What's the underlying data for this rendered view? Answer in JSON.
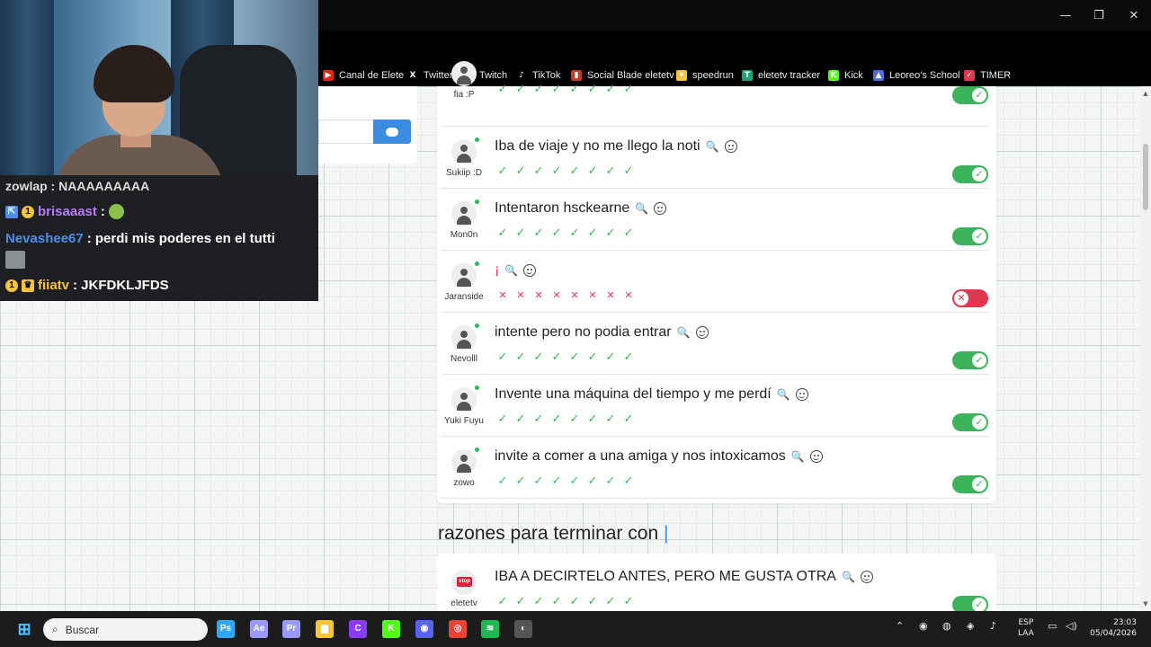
{
  "window": {
    "minimize": "—",
    "restore": "❐",
    "close": "✕"
  },
  "bookmarks": [
    {
      "label": "Canal de Elete",
      "icon": "youtube-icon",
      "color": "#e62117",
      "glyph": "▶"
    },
    {
      "label": "Twitter",
      "icon": "x-icon",
      "color": "#000000",
      "glyph": "X"
    },
    {
      "label": "Twitch",
      "icon": "twitch-icon",
      "color": "#9146ff",
      "glyph": "T"
    },
    {
      "label": "TikTok",
      "icon": "tiktok-icon",
      "color": "#000000",
      "glyph": "♪"
    },
    {
      "label": "Social Blade eletetv",
      "icon": "socialblade-icon",
      "color": "#c0392b",
      "glyph": "▮"
    },
    {
      "label": "speedrun",
      "icon": "speedrun-icon",
      "color": "#f5c542",
      "glyph": "✦"
    },
    {
      "label": "eletetv tracker",
      "icon": "tracker-icon",
      "color": "#1aa37a",
      "glyph": "T"
    },
    {
      "label": "Kick",
      "icon": "kick-icon",
      "color": "#53fc18",
      "glyph": "K"
    },
    {
      "label": "Leoreo's School",
      "icon": "school-icon",
      "color": "#4a6fd8",
      "glyph": "▲"
    },
    {
      "label": "TIMER",
      "icon": "timer-icon",
      "color": "#e0384e",
      "glyph": "✓"
    }
  ],
  "reasons": [
    {
      "user": "fia :P",
      "text": "",
      "votes": "ok",
      "state": "on"
    },
    {
      "user": "Sukiip :D",
      "text": "Iba de viaje y no me llego la noti",
      "votes": "ok",
      "state": "on"
    },
    {
      "user": "Mon0n",
      "text": "Intentaron hsckearne",
      "votes": "ok",
      "state": "on"
    },
    {
      "user": "Jaranside",
      "text": "¡",
      "votes": "x",
      "state": "off"
    },
    {
      "user": "Nevolll",
      "text": "intente pero no podia entrar",
      "votes": "ok",
      "state": "on"
    },
    {
      "user": "Yuki Fuyu",
      "text": "Invente una máquina del tiempo y me perdí",
      "votes": "ok",
      "state": "on"
    },
    {
      "user": "zowo",
      "text": "invite a comer a una amiga y nos intoxicamos",
      "votes": "ok",
      "state": "on"
    }
  ],
  "section2": {
    "title": "razones para terminar con",
    "cursor": "|",
    "item": {
      "user": "eletetv",
      "badge": "stop",
      "text": "IBA A DECIRTELO ANTES, PERO ME GUSTA OTRA",
      "state": "on"
    }
  },
  "chat": {
    "partial": "zowlap : NAAAAAAAAA",
    "messages": [
      {
        "user": "brisaaast",
        "color": "#b77dfa",
        "text": ":",
        "badge_num": "1"
      },
      {
        "user": "Nevashee67",
        "color": "#4f8ee8",
        "text": ": perdi mis poderes en el tutti"
      },
      {
        "user": "fiiatv",
        "color": "#f5c542",
        "text": ": JKFDKLJFDS",
        "badge_num": "1"
      }
    ]
  },
  "taskbar": {
    "search_placeholder": "Buscar",
    "apps": [
      {
        "name": "photoshop-app",
        "glyph": "Ps",
        "color": "#31a8ff"
      },
      {
        "name": "aftereffects-app",
        "glyph": "Ae",
        "color": "#9999ff"
      },
      {
        "name": "premiere-app",
        "glyph": "Pr",
        "color": "#9999ff"
      },
      {
        "name": "file-explorer-app",
        "glyph": "▆",
        "color": "#f8c537"
      },
      {
        "name": "canva-app",
        "glyph": "C",
        "color": "#8b3dff"
      },
      {
        "name": "kick-app",
        "glyph": "K",
        "color": "#53fc18"
      },
      {
        "name": "discord-app",
        "glyph": "◉",
        "color": "#5865f2"
      },
      {
        "name": "chrome-app",
        "glyph": "◎",
        "color": "#ea4335"
      },
      {
        "name": "spotify-app",
        "glyph": "≋",
        "color": "#1db954"
      },
      {
        "name": "obs-app",
        "glyph": "◐",
        "color": "#555555"
      }
    ],
    "lang1": "ESP",
    "lang2": "LAA",
    "time": "23:03",
    "date": "05/04/2026"
  },
  "colors": {
    "accent": "#3a8de0",
    "ok": "#3cb35a",
    "off": "#e0384e"
  }
}
